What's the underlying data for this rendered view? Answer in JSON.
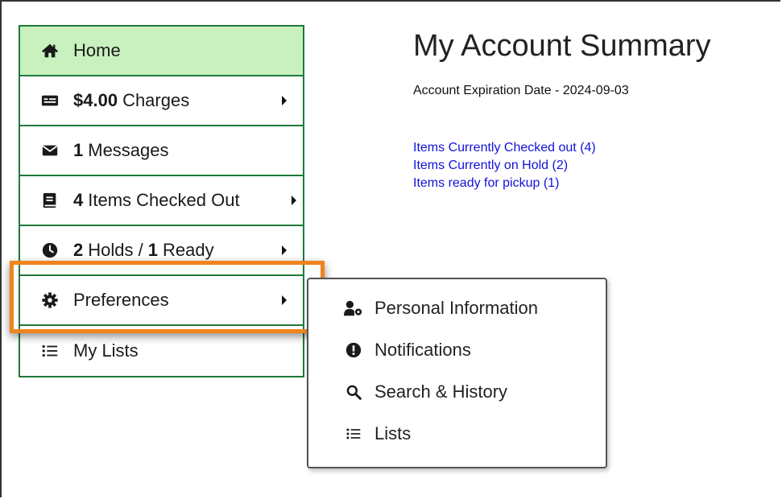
{
  "sidebar": {
    "items": [
      {
        "icon": "home-icon",
        "bold": "",
        "label": "Home"
      },
      {
        "icon": "money-bill-icon",
        "bold": "$4.00",
        "label": "Charges"
      },
      {
        "icon": "envelope-icon",
        "bold": "1",
        "label": "Messages"
      },
      {
        "icon": "book-icon",
        "bold": "4",
        "label": "Items Checked Out"
      },
      {
        "icon": "clock-icon",
        "bold": "2",
        "label": "Holds /",
        "bold2": "1",
        "label2": "Ready"
      },
      {
        "icon": "gear-icon",
        "bold": "",
        "label": "Preferences"
      },
      {
        "icon": "list-icon",
        "bold": "",
        "label": "My Lists"
      }
    ]
  },
  "main": {
    "title": "My Account Summary",
    "expiration": "Account Expiration Date - 2024-09-03",
    "links": [
      "Items Currently Checked out (4)",
      "Items Currently on Hold (2)",
      "Items ready for pickup (1)"
    ]
  },
  "dropdown": {
    "items": [
      {
        "icon": "user-gear-icon",
        "label": "Personal Information"
      },
      {
        "icon": "exclamation-circle-icon",
        "label": "Notifications"
      },
      {
        "icon": "search-icon",
        "label": "Search & History"
      },
      {
        "icon": "list-icon",
        "label": "Lists"
      }
    ]
  },
  "colors": {
    "nav_border": "#1f7a3a",
    "active_bg": "#c9f0bf",
    "highlight": "#f0841e",
    "link": "#1212d8"
  }
}
